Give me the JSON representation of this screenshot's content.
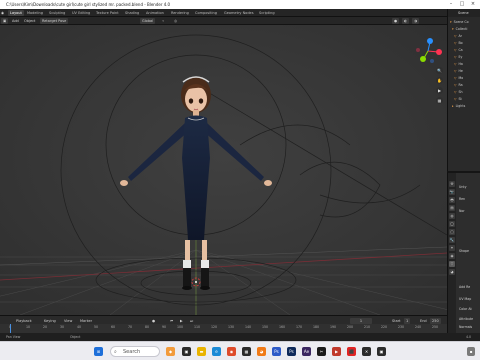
{
  "window": {
    "title": "C:\\Users\\Kim\\Downloads\\cute girl\\cute girl stylized mr. packed.blend - Blender 4.0"
  },
  "workspace_tabs": [
    "Layout",
    "Modeling",
    "Sculpting",
    "UV Editing",
    "Texture Paint",
    "Shading",
    "Animation",
    "Rendering",
    "Compositing",
    "Geometry Nodes",
    "Scripting"
  ],
  "active_workspace": "Layout",
  "scene_label": "Scene",
  "header": {
    "mode": "Object Mode",
    "view": "View",
    "select": "Select",
    "add": "Add",
    "object": "Object",
    "transform_space": "Global",
    "selection_mode": "Select Box",
    "retarget": "Retarget Pose",
    "options": "Options"
  },
  "outliner": {
    "title": "Scene Collection",
    "rows": [
      "Scene Co",
      "Collecti",
      "Ar",
      "Bo",
      "Ca",
      "Ey",
      "Ha",
      "He",
      "Mo",
      "Ra",
      "Sh",
      "St",
      "Lights"
    ]
  },
  "properties": {
    "object_label": "Unty",
    "labels": [
      "Ren",
      "Nor",
      "Shape",
      "Add Re",
      "UV Map",
      "Color At",
      "Attribute",
      "Normals",
      "Texture"
    ]
  },
  "timeline": {
    "menus": [
      "Playback",
      "Keying",
      "View",
      "Marker"
    ],
    "current_frame": "1",
    "start_label": "Start",
    "start": "1",
    "end_label": "End",
    "end": "250",
    "ticks": [
      "0",
      "10",
      "20",
      "30",
      "40",
      "50",
      "60",
      "70",
      "80",
      "90",
      "100",
      "110",
      "120",
      "130",
      "140",
      "150",
      "160",
      "170",
      "180",
      "190",
      "200",
      "210",
      "220",
      "230",
      "240",
      "250"
    ]
  },
  "statusbar": {
    "left": "Pan View",
    "mid": "Object",
    "right": "4.0"
  },
  "taskbar": {
    "search_placeholder": "Search"
  },
  "colors": {
    "viewport_bg": "#393939",
    "accent": "#f0a048",
    "x_axis": "#ff3352",
    "y_axis": "#8bdc00",
    "z_axis": "#2890ff"
  }
}
